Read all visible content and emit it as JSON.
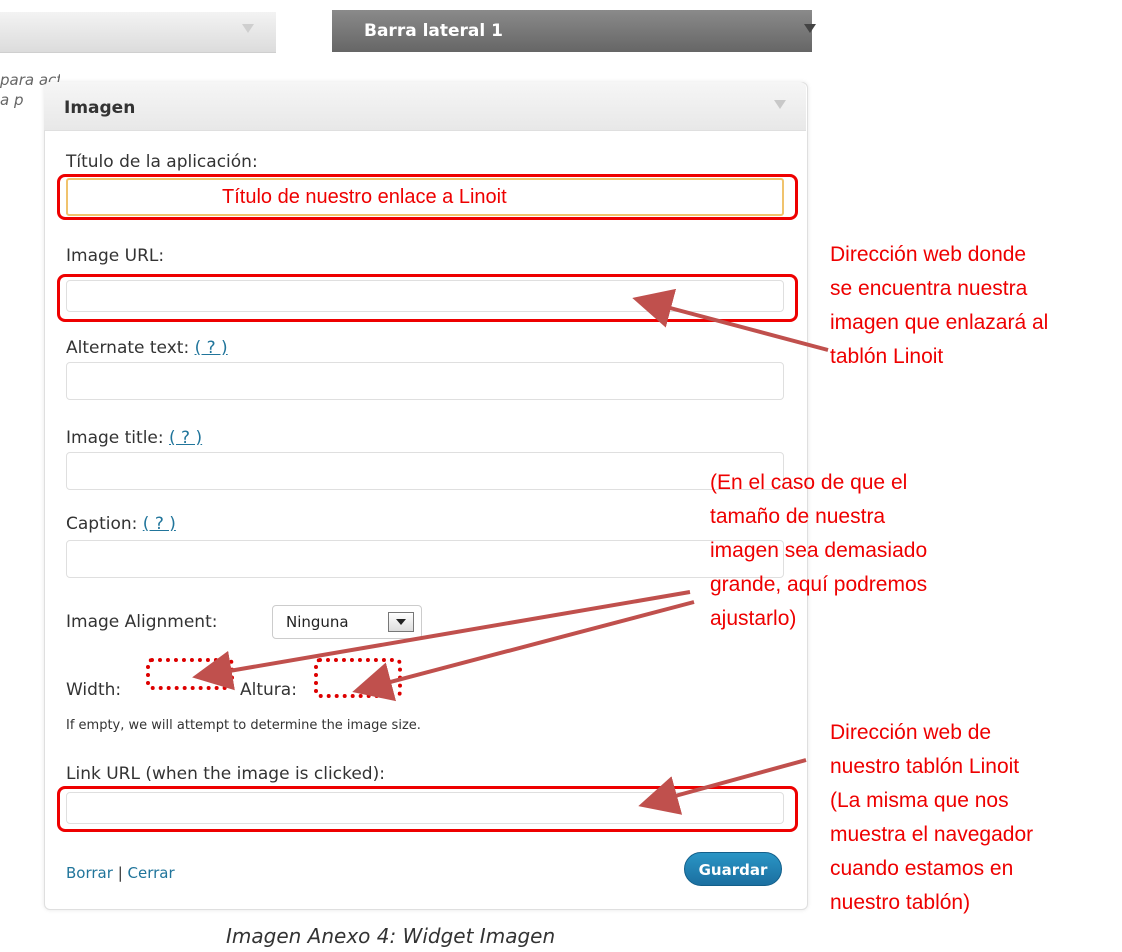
{
  "background": {
    "left_panel_text_lines": [
      "para activarlos",
      "a p"
    ],
    "sidebar_title": "Barra lateral 1"
  },
  "widget": {
    "title": "Imagen",
    "app_title_label": "Título de la aplicación:",
    "app_title_value": "Título de nuestro enlace a Linoit",
    "image_url_label": "Image URL:",
    "alt_text_label": "Alternate text:",
    "image_title_label": "Image title:",
    "caption_label": "Caption:",
    "help_link": "( ? )",
    "alignment_label": "Image Alignment:",
    "alignment_value": "Ninguna",
    "width_label": "Width:",
    "height_label": "Altura:",
    "size_hint": "If empty, we will attempt to determine the image size.",
    "link_url_label": "Link URL (when the image is clicked):",
    "delete_link": "Borrar",
    "separator": "|",
    "close_link": "Cerrar",
    "save_button": "Guardar"
  },
  "annotations": {
    "image_url_note": [
      " Dirección web donde",
      "se encuentra nuestra",
      "imagen que enlazará al",
      "tablón Linoit"
    ],
    "size_note": [
      "(En el caso de que el",
      "tamaño de nuestra",
      "imagen sea demasiado",
      "grande, aquí podremos",
      "ajustarlo)"
    ],
    "link_url_note": [
      " Dirección web de",
      "nuestro tablón Linoit",
      "(La misma que nos",
      "muestra el navegador",
      "cuando estamos en",
      "nuestro tablón)"
    ]
  },
  "figure_caption": "Imagen Anexo 4: Widget Imagen",
  "colors": {
    "annotation": "#e00000",
    "link": "#21759b",
    "save_button": "#1b6fa0"
  }
}
